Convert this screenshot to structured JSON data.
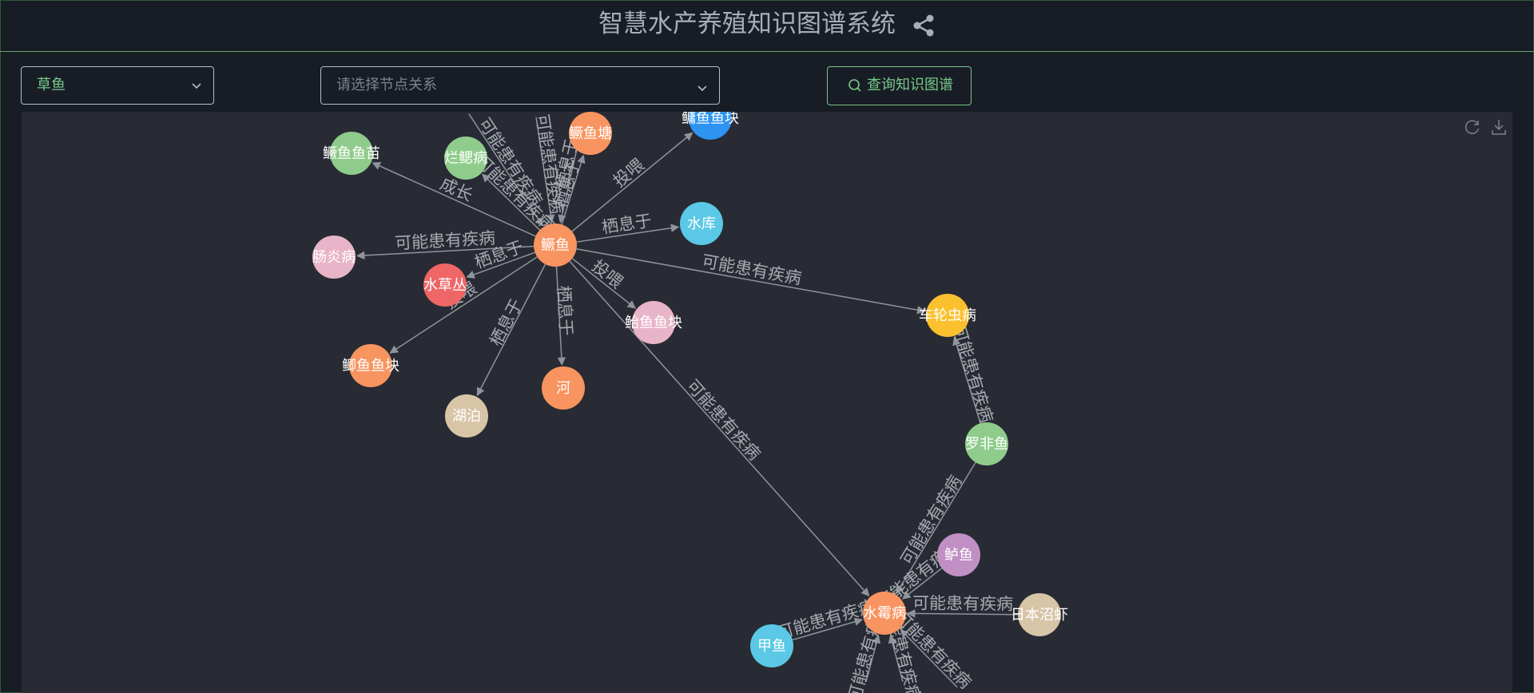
{
  "app": {
    "title": "智慧水产养殖知识图谱系统",
    "title_icon": "share-icon"
  },
  "toolbar": {
    "entity_select": {
      "value": "草鱼"
    },
    "relation_select": {
      "placeholder": "请选择节点关系"
    },
    "query_button": {
      "label": "查询知识图谱",
      "icon": "search-icon"
    },
    "graph_tools": [
      {
        "name": "restore-icon"
      },
      {
        "name": "download-icon"
      }
    ]
  },
  "colors": {
    "accent": "#77c98a",
    "edge": "#8f949c",
    "edge_label": "#a6aab1",
    "background": "#181c25",
    "canvas": "#282b33"
  },
  "graph": {
    "nodes": [
      {
        "id": "n0",
        "label": "鳜鱼",
        "color": "#f89460"
      },
      {
        "id": "n1",
        "label": "鳜鱼鱼苗",
        "color": "#8fcc8b"
      },
      {
        "id": "n2",
        "label": "烂鳃病",
        "color": "#8fcc8b"
      },
      {
        "id": "n3",
        "label": "鳜鱼塘",
        "color": "#f89460"
      },
      {
        "id": "n4",
        "label": "鳙鱼鱼块",
        "color": "#2e94f2"
      },
      {
        "id": "n5",
        "label": "水库",
        "color": "#5ac8e6"
      },
      {
        "id": "n6",
        "label": "肠炎病",
        "color": "#e8b4c8"
      },
      {
        "id": "n7",
        "label": "水草丛",
        "color": "#ee6666"
      },
      {
        "id": "n8",
        "label": "鲫鱼鱼块",
        "color": "#f89460"
      },
      {
        "id": "n9",
        "label": "湖泊",
        "color": "#d8c5a8"
      },
      {
        "id": "n10",
        "label": "河",
        "color": "#f89460"
      },
      {
        "id": "n11",
        "label": "鲐鱼鱼块",
        "color": "#e8b4c8"
      },
      {
        "id": "n12",
        "label": "车轮虫病",
        "color": "#fbc02d"
      },
      {
        "id": "n13",
        "label": "罗非鱼",
        "color": "#8fcc8b"
      },
      {
        "id": "n14",
        "label": "鲈鱼",
        "color": "#c08fc4"
      },
      {
        "id": "n15",
        "label": "水霉病",
        "color": "#f89460"
      },
      {
        "id": "n16",
        "label": "日本沼虾",
        "color": "#d8c5a8"
      },
      {
        "id": "n17",
        "label": "甲鱼",
        "color": "#5ac8e6"
      }
    ],
    "edges": [
      {
        "from": "n0",
        "to": "n1",
        "label": "成长"
      },
      {
        "from": "n0",
        "to": "n2",
        "label": "可能患有疾病"
      },
      {
        "from": "n0",
        "to": "n3",
        "label": "栖息于"
      },
      {
        "from": "n0",
        "to": "n4",
        "label": "投喂"
      },
      {
        "from": "n0",
        "to": "n5",
        "label": "栖息于"
      },
      {
        "from": "n0",
        "to": "n6",
        "label": "可能患有疾病"
      },
      {
        "from": "n0",
        "to": "n7",
        "label": "栖息于"
      },
      {
        "from": "n0",
        "to": "n8",
        "label": "投喂"
      },
      {
        "from": "n0",
        "to": "n9",
        "label": "栖息于"
      },
      {
        "from": "n0",
        "to": "n10",
        "label": "栖息于"
      },
      {
        "from": "n0",
        "to": "n11",
        "label": "投喂"
      },
      {
        "from": "n0",
        "to": "n12",
        "label": "可能患有疾病"
      },
      {
        "from": "n0",
        "to": "n15",
        "label": "可能患有疾病"
      },
      {
        "from": "n13",
        "to": "n12",
        "label": "可能患有疾病"
      },
      {
        "from": "n13",
        "to": "n15",
        "label": "可能患有疾病"
      },
      {
        "from": "n14",
        "to": "n15",
        "label": "可能患有疾病"
      },
      {
        "from": "n16",
        "to": "n15",
        "label": "可能患有疾病"
      },
      {
        "from": "n17",
        "to": "n15",
        "label": "可能患有疾病"
      },
      {
        "from": "x1",
        "to": "n15",
        "label": "可能患有疾病"
      },
      {
        "from": "x2",
        "to": "n15",
        "label": "可能患有疾病"
      },
      {
        "from": "x3",
        "to": "n15",
        "label": "可能患有疾病"
      },
      {
        "from": "x4",
        "to": "n0",
        "label": "可能患有疾病"
      },
      {
        "from": "x5",
        "to": "n0",
        "label": "可能患有疾病"
      },
      {
        "from": "x6",
        "to": "n0",
        "label": "栖息于"
      }
    ]
  }
}
